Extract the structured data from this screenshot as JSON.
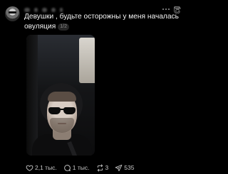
{
  "post": {
    "text": "Девушки , будьте осторожны у меня началась овуляция",
    "page_indicator": "1/2"
  },
  "actions": {
    "likes": "2,1 тыс.",
    "replies": "1 тыс.",
    "reposts": "3",
    "shares": "535"
  },
  "colors": {
    "background": "#000000",
    "text": "#f4f4f4",
    "muted": "#8a8a8a"
  },
  "icons": [
    "more-icon",
    "threads-icon",
    "heart-icon",
    "comment-icon",
    "repost-icon",
    "share-icon"
  ]
}
